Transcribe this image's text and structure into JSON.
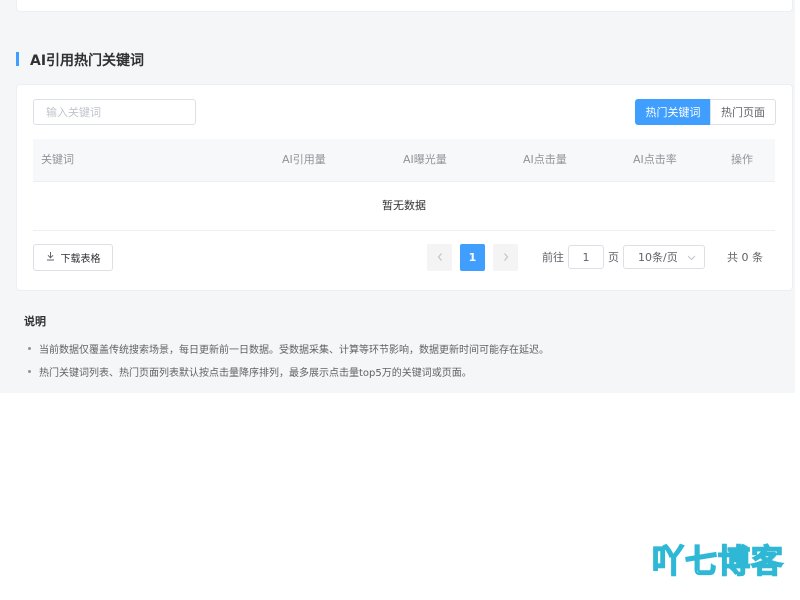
{
  "section": {
    "title": "AI引用热门关键词"
  },
  "search": {
    "placeholder": "输入关键词",
    "value": ""
  },
  "toggle": {
    "options": [
      "热门关键词",
      "热门页面"
    ],
    "active": 0
  },
  "table": {
    "columns": [
      "关键词",
      "AI引用量",
      "AI曝光量",
      "AI点击量",
      "AI点击率",
      "操作"
    ],
    "rows": [],
    "empty_text": "暂无数据"
  },
  "toolbar": {
    "download_label": "下载表格",
    "download_icon": "download-icon"
  },
  "pagination": {
    "prev_icon": "chevron-left-icon",
    "next_icon": "chevron-right-icon",
    "current_page": "1",
    "goto_prefix": "前往",
    "goto_value": "1",
    "goto_suffix": "页",
    "page_size": "10条/页",
    "total_text": "共 0 条"
  },
  "notes": {
    "title": "说明",
    "items": [
      "当前数据仅覆盖传统搜索场景，每日更新前一日数据。受数据采集、计算等环节影响，数据更新时间可能存在延迟。",
      "热门关键词列表、热门页面列表默认按点击量降序排列，最多展示点击量top5万的关键词或页面。"
    ]
  },
  "watermark": {
    "text": "吖七博客"
  },
  "colors": {
    "primary": "#409eff",
    "watermark": "#2fb8d6"
  }
}
